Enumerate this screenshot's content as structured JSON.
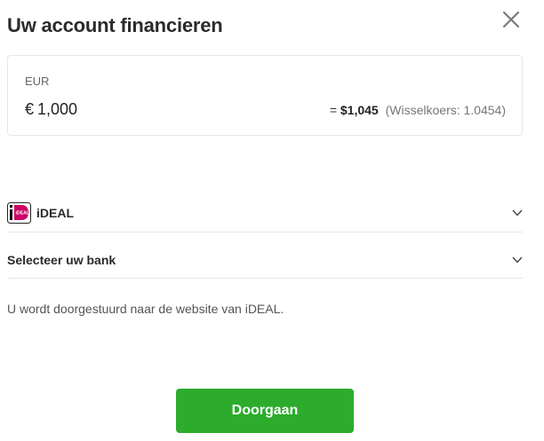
{
  "dialog": {
    "title": "Uw account financieren"
  },
  "amount": {
    "currency_label": "EUR",
    "currency_symbol": "€",
    "value": "1,000",
    "equals": "=",
    "converted_value": "$1,045",
    "exchange_rate": "(Wisselkoers: 1.0454)"
  },
  "payment_method": {
    "label": "iDEAL",
    "logo_text": "iDEAL",
    "icon": "ideal-logo"
  },
  "bank_select": {
    "label": "Selecteer uw bank"
  },
  "info": {
    "redirect_text": "U wordt doorgestuurd naar de website van iDEAL."
  },
  "actions": {
    "continue_label": "Doorgaan"
  },
  "colors": {
    "primary_button": "#2dab2d",
    "ideal_pink": "#cc0066",
    "border": "#e6e6e6"
  }
}
